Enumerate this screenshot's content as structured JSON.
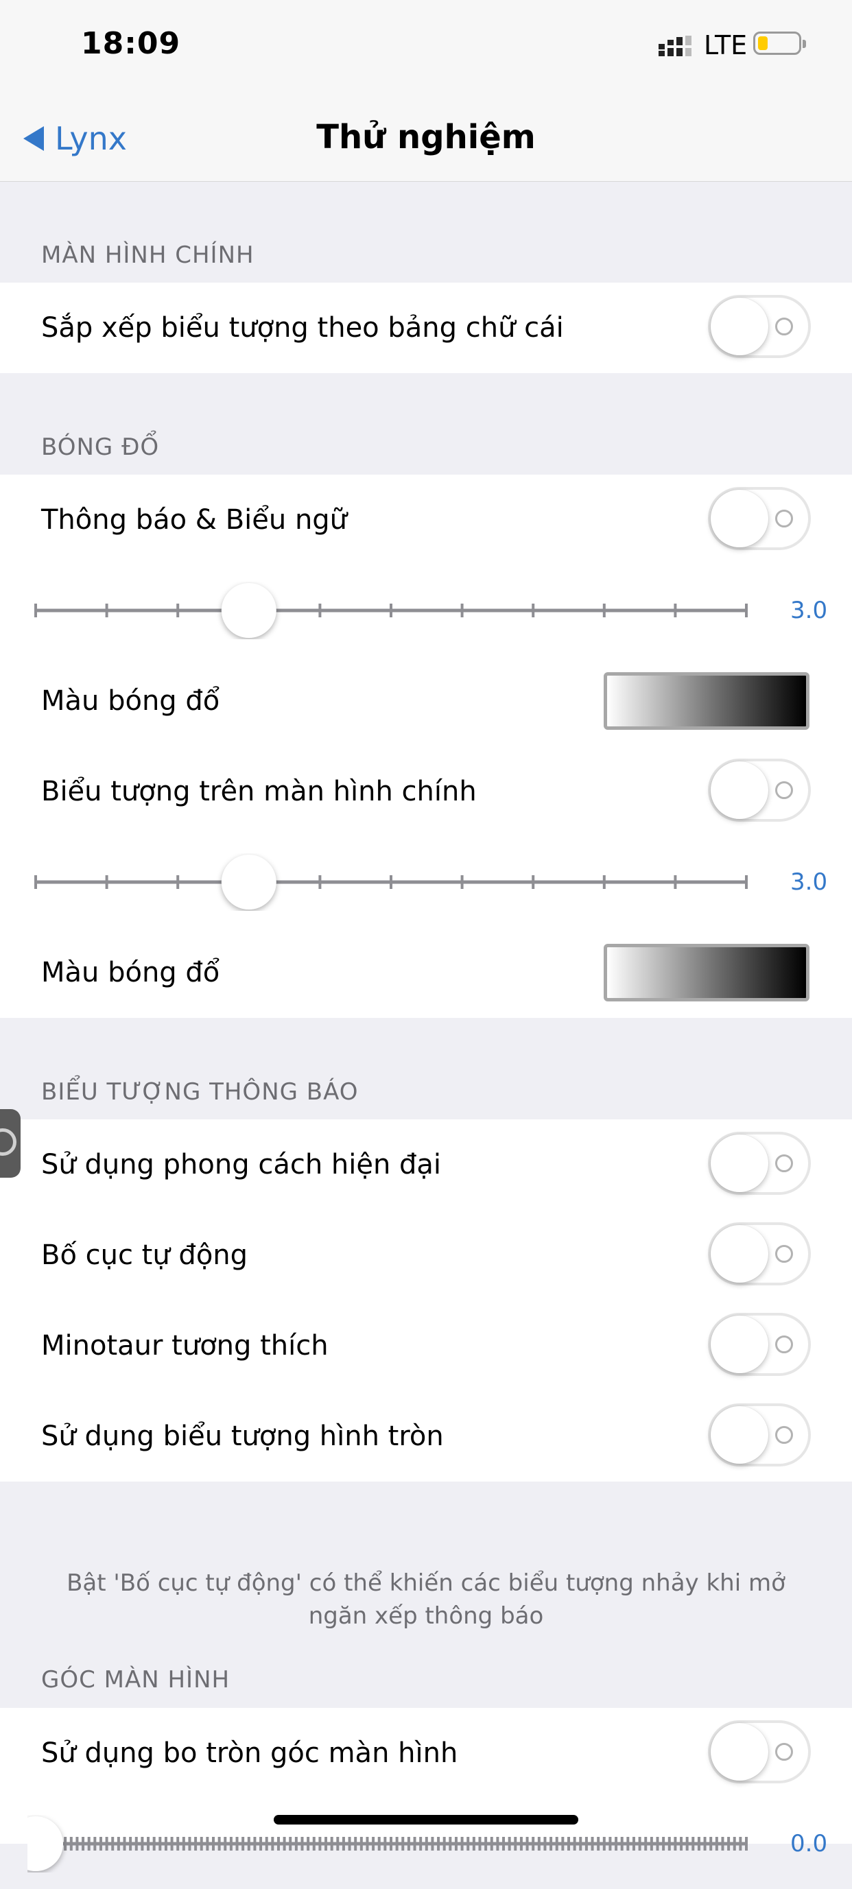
{
  "status_bar": {
    "time": "18:09",
    "network": "LTE",
    "icons": [
      "signal-icon",
      "battery-icon"
    ],
    "battery_color": "#ffcc00"
  },
  "nav": {
    "back_label": "Lynx",
    "title": "Thử nghiệm"
  },
  "accent_color": "#3478c9",
  "sections": {
    "home": {
      "header": "MÀN HÌNH CHÍNH",
      "rows": [
        {
          "label": "Sắp xếp biểu tượng theo bảng chữ cái",
          "on": false
        }
      ]
    },
    "shadow": {
      "header": "BÓNG ĐỔ",
      "notif_toggle": {
        "label": "Thông báo & Biểu ngữ",
        "on": false
      },
      "slider1": {
        "value_text": "3.0",
        "level": 0.3
      },
      "color1": {
        "label": "Màu bóng đổ"
      },
      "icon_toggle": {
        "label": "Biểu tượng trên màn hình chính",
        "on": false
      },
      "slider2": {
        "value_text": "3.0",
        "level": 0.3
      },
      "color2": {
        "label": "Màu bóng đổ"
      }
    },
    "badge": {
      "header": "BIỂU TƯỢNG THÔNG BÁO",
      "rows": [
        {
          "label": "Sử dụng phong cách hiện đại",
          "on": false
        },
        {
          "label": "Bố cục tự động",
          "on": false
        },
        {
          "label": "Minotaur tương thích",
          "on": false
        },
        {
          "label": "Sử dụng biểu tượng hình tròn",
          "on": false
        }
      ],
      "footer": "Bật 'Bố cục tự động' có thể khiến các biểu tượng nhảy khi mở ngăn xếp thông báo"
    },
    "corners": {
      "header": "GÓC MÀN HÌNH",
      "rows": [
        {
          "label": "Sử dụng bo tròn góc màn hình",
          "on": false
        }
      ],
      "slider": {
        "value_text": "0.0",
        "level": 0.0
      }
    }
  }
}
